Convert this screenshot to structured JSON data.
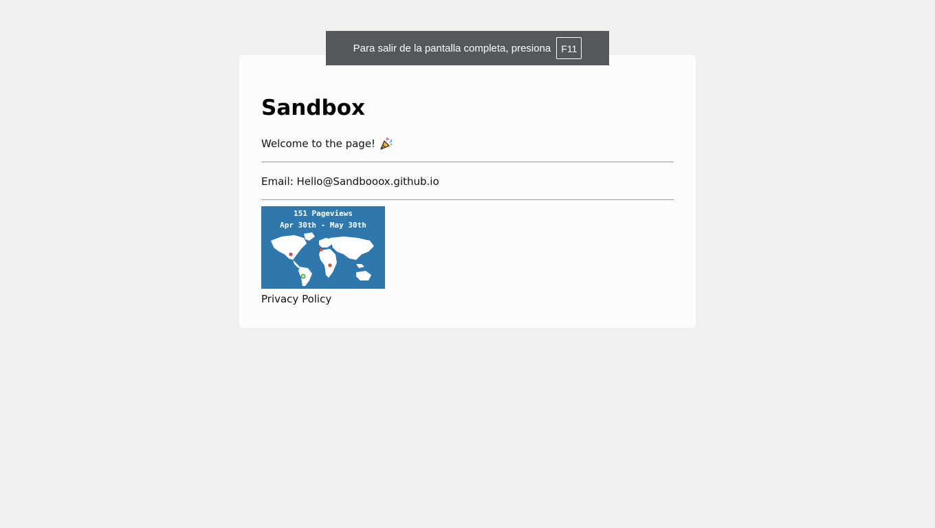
{
  "fullscreen_notice": {
    "message": "Para salir de la pantalla completa, presiona",
    "key": "F11"
  },
  "page": {
    "title": "Sandbox",
    "welcome_text": "Welcome to the page!",
    "welcome_icon": "party-popper-icon",
    "email_line": "Email: Hello@Sandbooox.github.io",
    "privacy_link": "Privacy Policy"
  },
  "visitor_map": {
    "pageviews_label": "151 Pageviews",
    "date_range": "Apr 30th - May 30th",
    "background_color": "#2e78ad",
    "dot_color": "#e05a5a",
    "highlight_dot_color": "#9ef08a"
  }
}
